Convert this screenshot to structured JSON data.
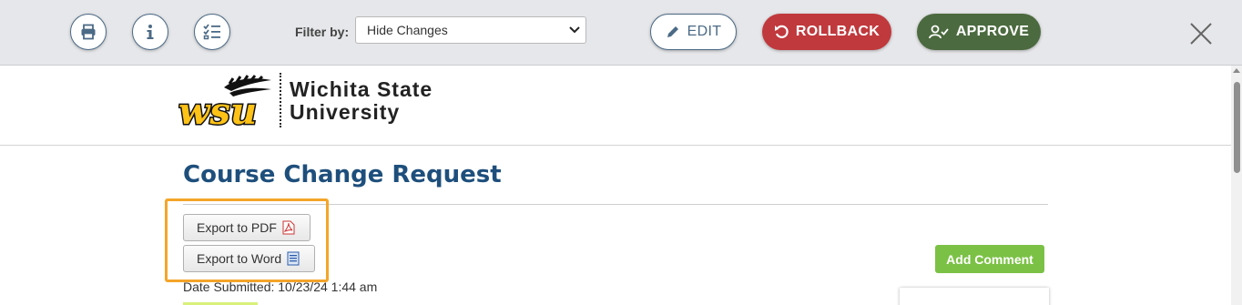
{
  "toolbar": {
    "filter_label": "Filter by:",
    "filter_value": "Hide Changes",
    "edit_label": "EDIT",
    "rollback_label": "ROLLBACK",
    "approve_label": "APPROVE",
    "icons": [
      "print-icon",
      "info-icon",
      "checklist-icon",
      "pencil-icon",
      "undo-icon",
      "user-check-icon",
      "close-icon"
    ]
  },
  "header": {
    "logo_mark": "wsu",
    "logo_line1": "Wichita State",
    "logo_line2": "University"
  },
  "main": {
    "title": "Course Change Request",
    "export_pdf_label": "Export to PDF",
    "export_word_label": "Export to Word",
    "add_comment_label": "Add Comment",
    "date_submitted": "Date Submitted: 10/23/24 1:44 am"
  },
  "colors": {
    "rollback": "#c0393d",
    "approve": "#4b6a3f",
    "add_comment": "#7bc145",
    "title": "#1e4f7c",
    "highlight": "#f4a52a"
  }
}
